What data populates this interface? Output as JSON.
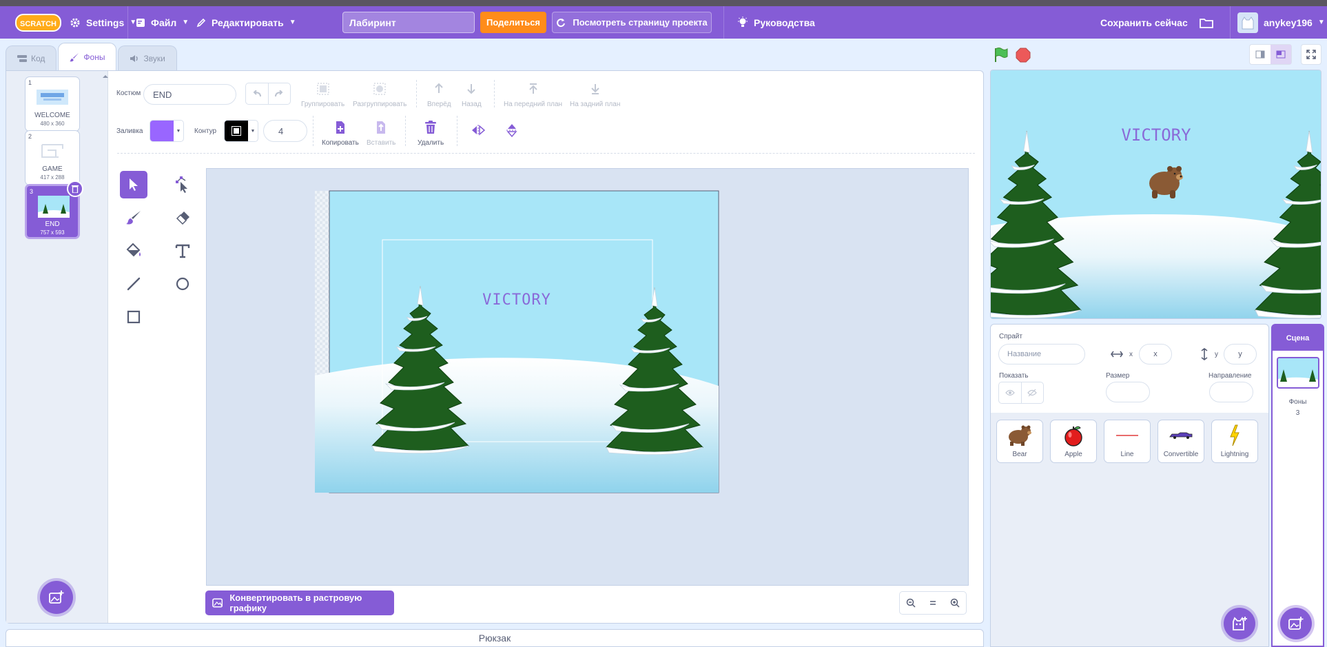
{
  "menubar": {
    "logo_text": "SCRATCH",
    "settings": "Settings",
    "file": "Файл",
    "edit": "Редактировать",
    "project_title": "Лабиринт",
    "share": "Поделиться",
    "see_project_page": "Посмотреть страницу проекта",
    "tutorials": "Руководства",
    "save_now": "Сохранить сейчас",
    "username": "anykey196"
  },
  "tabs": [
    {
      "label": "Код",
      "icon": "code-icon"
    },
    {
      "label": "Фоны",
      "icon": "brush-icon"
    },
    {
      "label": "Звуки",
      "icon": "speaker-icon"
    }
  ],
  "costumes": [
    {
      "num": "1",
      "name": "WELCOME",
      "size": "480 x 360"
    },
    {
      "num": "2",
      "name": "GAME",
      "size": "417 x 288"
    },
    {
      "num": "3",
      "name": "END",
      "size": "757 x 593"
    }
  ],
  "paint_editor": {
    "costume_label": "Костюм",
    "costume_name": "END",
    "group": "Группировать",
    "ungroup": "Разгруппировать",
    "forward": "Вперёд",
    "backward": "Назад",
    "front": "На передний план",
    "back": "На задний план",
    "fill_label": "Заливка",
    "fill_color": "#9966ff",
    "outline_label": "Контур",
    "outline_color": "#000000",
    "outline_width": "4",
    "copy": "Копировать",
    "paste": "Вставить",
    "delete": "Удалить",
    "convert": "Конвертировать в растровую графику",
    "canvas_text": "VICTORY"
  },
  "backpack": "Рюкзак",
  "stage_text": "VICTORY",
  "sprite_info": {
    "sprite_label": "Спрайт",
    "name_placeholder": "Название",
    "x_label": "x",
    "x_placeholder": "x",
    "y_label": "y",
    "y_placeholder": "y",
    "show_label": "Показать",
    "size_label": "Размер",
    "direction_label": "Направление"
  },
  "sprites": [
    {
      "name": "Bear",
      "icon": "bear-icon"
    },
    {
      "name": "Apple",
      "icon": "apple-icon"
    },
    {
      "name": "Line",
      "icon": "line-icon"
    },
    {
      "name": "Convertible",
      "icon": "car-icon"
    },
    {
      "name": "Lightning",
      "icon": "lightning-icon"
    }
  ],
  "stage_pane": {
    "title": "Сцена",
    "backdrops_label": "Фоны",
    "backdrops_count": "3"
  },
  "colors": {
    "accent": "#855cd6",
    "share": "#ff8c1a",
    "sky": "#a8e6f8",
    "tree": "#1e5e1e"
  }
}
